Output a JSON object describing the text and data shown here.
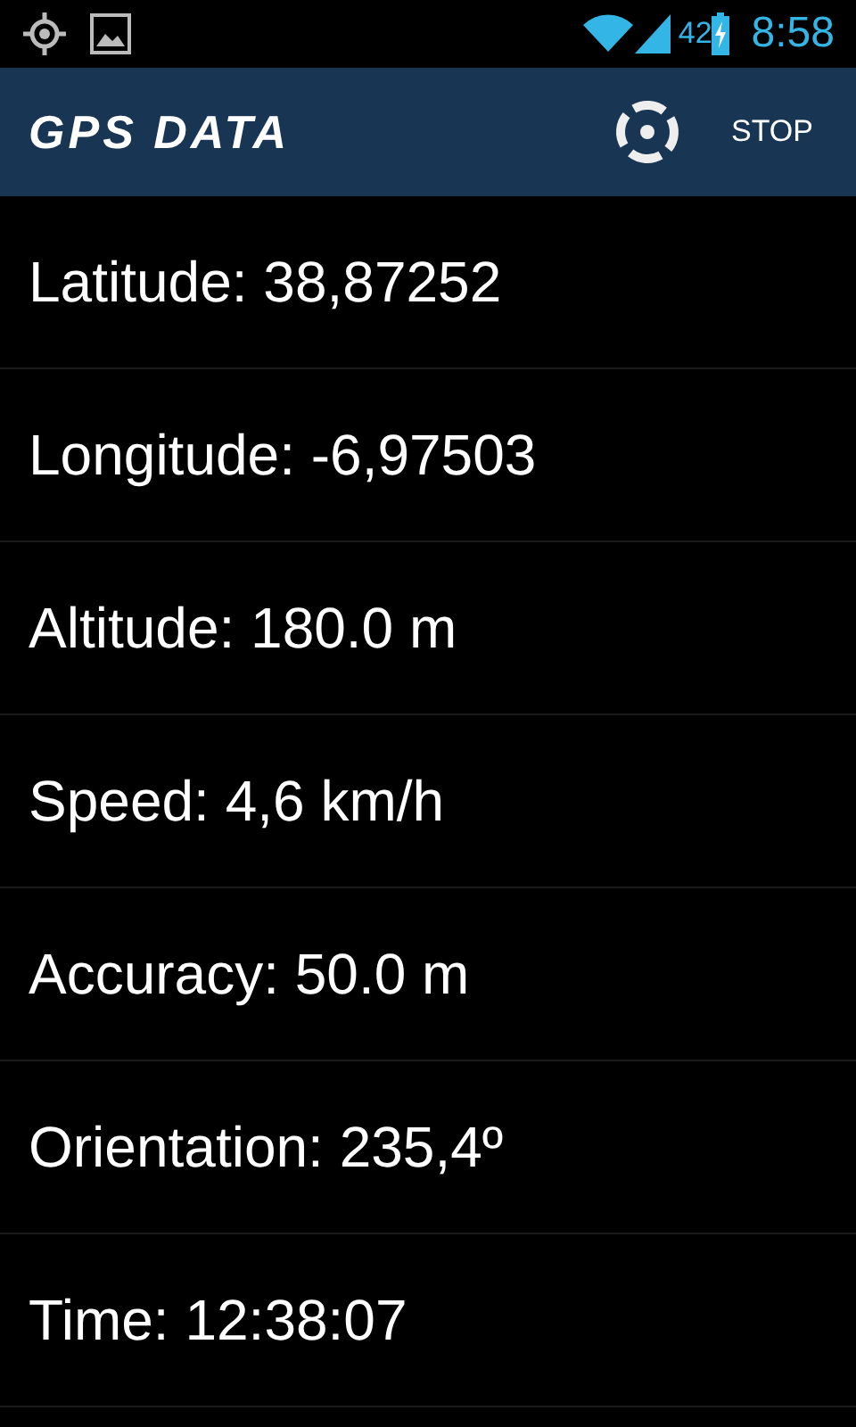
{
  "status_bar": {
    "battery_percent": "42",
    "time": "8:58"
  },
  "action_bar": {
    "title": "GPS DATA",
    "action": "STOP"
  },
  "readings": [
    {
      "text": "Latitude: 38,87252"
    },
    {
      "text": "Longitude: -6,97503"
    },
    {
      "text": "Altitude: 180.0 m"
    },
    {
      "text": "Speed: 4,6 km/h"
    },
    {
      "text": "Accuracy: 50.0 m"
    },
    {
      "text": "Orientation: 235,4º"
    },
    {
      "text": "Time: 12:38:07"
    }
  ]
}
